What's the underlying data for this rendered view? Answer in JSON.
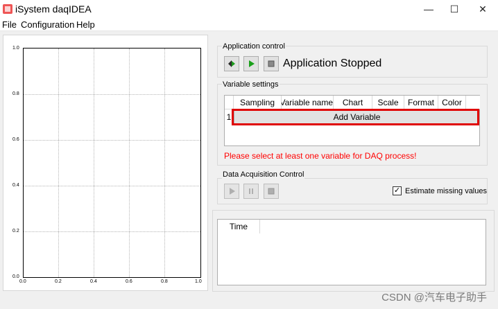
{
  "window": {
    "title": "iSystem daqIDEA",
    "minimize": "—",
    "maximize": "☐",
    "close": "✕"
  },
  "menu": [
    "File",
    "Configuration",
    "Help"
  ],
  "plot": {
    "y_ticks": [
      "1.0",
      "0.8",
      "0.6",
      "0.4",
      "0.2",
      "0.0"
    ],
    "x_ticks": [
      "0.0",
      "0.2",
      "0.4",
      "0.6",
      "0.8",
      "1.0"
    ]
  },
  "app_control": {
    "title": "Application control",
    "status": "Application Stopped",
    "buttons": [
      "step-icon",
      "play-icon",
      "stop-icon"
    ]
  },
  "variable_settings": {
    "title": "Variable settings",
    "columns": [
      "Sampling",
      "Variable name",
      "Chart",
      "Scale",
      "Format",
      "Color"
    ],
    "row_number": "1",
    "add_label": "Add Variable",
    "warning": "Please select at least one variable for DAQ process!",
    "highlight_color": "#e00000"
  },
  "daq_control": {
    "title": "Data Acquisition Control",
    "buttons": [
      "play-icon",
      "pause-icon",
      "stop-icon"
    ],
    "checkbox_label": "Estimate missing values",
    "checkbox_checked": true
  },
  "log": {
    "column": "Time"
  },
  "watermark": "CSDN @汽车电子助手"
}
